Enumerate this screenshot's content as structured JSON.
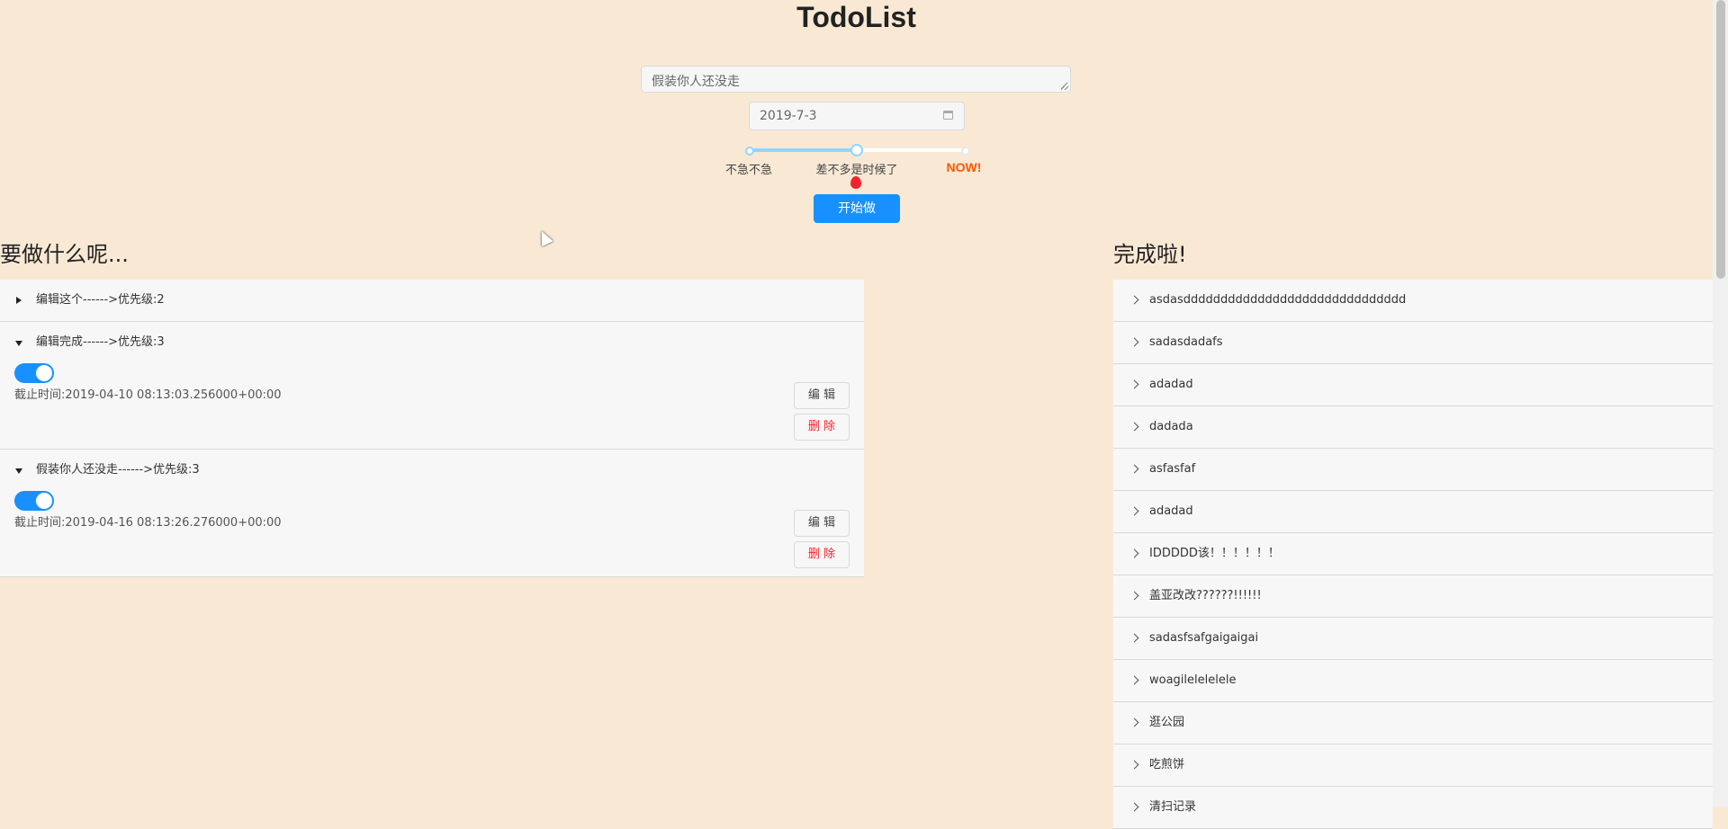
{
  "app": {
    "title": "TodoList"
  },
  "form": {
    "todo_value": "假装你人还没走",
    "date_value": "2019-7-3",
    "priority_marks": [
      "不急不急",
      "差不多是时候了",
      "NOW!"
    ],
    "priority_level": 0.5,
    "submit_label": "开始做"
  },
  "todo": {
    "heading": "要做什么呢...",
    "items": [
      {
        "title": "编辑这个------>优先级:2",
        "expanded": false
      },
      {
        "title": "编辑完成------>优先级:3",
        "expanded": true,
        "done": true,
        "deadline": "截止时间:2019-04-10 08:13:03.256000+00:00",
        "edit_label": "编 辑",
        "delete_label": "删 除"
      },
      {
        "title": "假装你人还没走------>优先级:3",
        "expanded": true,
        "done": true,
        "deadline": "截止时间:2019-04-16 08:13:26.276000+00:00",
        "edit_label": "编 辑",
        "delete_label": "删 除"
      }
    ]
  },
  "done": {
    "heading": "完成啦!",
    "items": [
      "asdasdddddddddddddddddddddddddddddd",
      "sadasdadafs",
      "adadad",
      "dadada",
      "asfasfaf",
      "adadad",
      "IDDDDD该！！！！！！",
      "盖亚改改??????!!!!!!",
      "sadasfsafgaigaigai",
      "woagilelelelele",
      "逛公园",
      "吃煎饼",
      "清扫记录"
    ]
  },
  "colors": {
    "background": "#f9e9d4",
    "primary": "#1890ff",
    "danger": "#f5222d",
    "now": "#ff5500"
  }
}
